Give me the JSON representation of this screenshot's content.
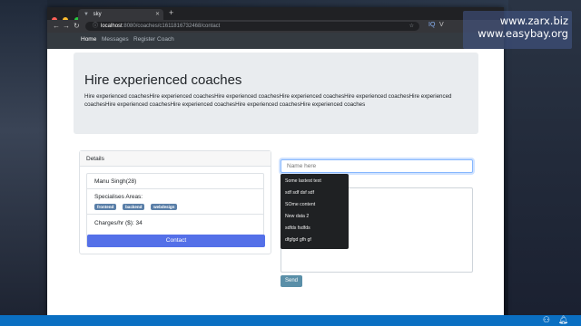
{
  "watermark": {
    "line1": "www.zarx.biz",
    "line2": "www.easybay.org"
  },
  "browser": {
    "tab_title": "sky",
    "url_host": "localhost",
    "url_path": ":8080/coaches/c1611816732468/contact",
    "ext_label": "IQ"
  },
  "nav": {
    "home": "Home",
    "messages": "Messages",
    "register": "Register Coach"
  },
  "hero": {
    "title": "Hire experienced coaches",
    "text": "Hire experienced coachesHire experienced coachesHire experienced coachesHire experienced coachesHire experienced coachesHire experienced coachesHire experienced coachesHire experienced coachesHire experienced coachesHire experienced coaches"
  },
  "details": {
    "header": "Details",
    "name": "Manu Singh(28)",
    "specialises_label": "Specialises Areas:",
    "areas": [
      "frontend",
      "backend",
      "webdesign"
    ],
    "charges": "Charges/hr ($): 34",
    "contact_button": "Contact"
  },
  "form": {
    "name_placeholder": "Name here",
    "send_button": "Send",
    "suggestions": [
      "Some lastest text",
      "sdf sdf dsf sdf",
      "SOme content",
      "New data 2",
      "sdfds fsdfds",
      "dfgfgd gfh gf"
    ]
  },
  "colors": {
    "accent": "#5470e8",
    "badge": "#5a7fa8",
    "nav_bg": "#343a40",
    "send": "#5a8fa8"
  }
}
